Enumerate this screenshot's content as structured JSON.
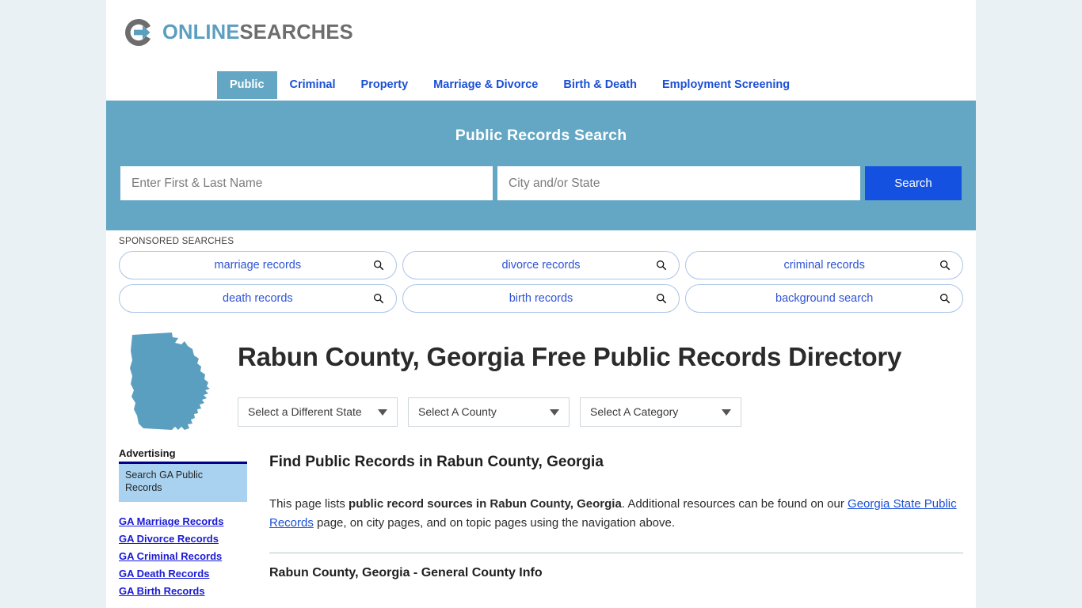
{
  "brand": {
    "logo_icon": "circular-arrow-logo-icon",
    "name_part1": "ONLINE",
    "name_part2": "SEARCHES",
    "accent_color": "#5b9fc0",
    "gray_color": "#6d6d6d"
  },
  "nav": {
    "items": [
      {
        "label": "Public",
        "active": true
      },
      {
        "label": "Criminal",
        "active": false
      },
      {
        "label": "Property",
        "active": false
      },
      {
        "label": "Marriage & Divorce",
        "active": false
      },
      {
        "label": "Birth & Death",
        "active": false
      },
      {
        "label": "Employment Screening",
        "active": false
      }
    ]
  },
  "search_band": {
    "title": "Public Records Search",
    "band_color": "#64a7c4",
    "name_placeholder": "Enter First & Last Name",
    "name_value": "",
    "city_placeholder": "City and/or State",
    "city_value": "",
    "submit_label": "Search",
    "submit_color": "#1551e0"
  },
  "sponsored": {
    "label": "SPONSORED SEARCHES",
    "row1": [
      {
        "text": "marriage records",
        "icon": "search-icon"
      },
      {
        "text": "divorce records",
        "icon": "search-icon"
      },
      {
        "text": "criminal records",
        "icon": "search-icon"
      }
    ],
    "row2": [
      {
        "text": "death records",
        "icon": "search-icon"
      },
      {
        "text": "birth records",
        "icon": "search-icon"
      },
      {
        "text": "background search",
        "icon": "search-icon"
      }
    ]
  },
  "hero": {
    "map_icon": "georgia-state-map-icon",
    "map_color": "#5b9fc0",
    "title": "Rabun County, Georgia Free Public Records Directory"
  },
  "filters": [
    {
      "label": "Select a Different State",
      "icon": "chevron-down-icon"
    },
    {
      "label": "Select A County",
      "icon": "chevron-down-icon"
    },
    {
      "label": "Select A Category",
      "icon": "chevron-down-icon"
    }
  ],
  "sidebar": {
    "advertising_heading": "Advertising",
    "ad_box_text": "Search GA Public Records",
    "links": [
      {
        "label": "GA Marriage Records"
      },
      {
        "label": "GA Divorce Records"
      },
      {
        "label": "GA Criminal Records"
      },
      {
        "label": "GA Death Records"
      },
      {
        "label": "GA Birth Records"
      }
    ]
  },
  "main": {
    "section_heading": "Find Public Records in Rabun County, Georgia",
    "intro_p1": "This page lists ",
    "intro_bold": "public record sources in Rabun County, Georgia",
    "intro_p2": ". Additional resources can be found on our ",
    "intro_link": "Georgia State Public Records",
    "intro_p3": " page, on city pages, and on topic pages using the navigation above.",
    "subsection_heading": "Rabun County, Georgia - General County Info"
  }
}
